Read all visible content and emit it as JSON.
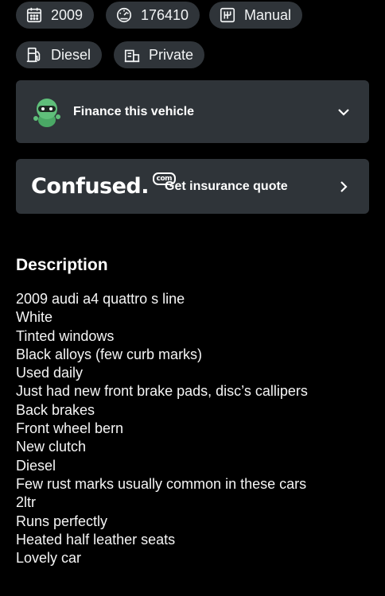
{
  "specs": {
    "year": "2009",
    "mileage": "176410",
    "transmission": "Manual",
    "fuel": "Diesel",
    "seller": "Private"
  },
  "finance": {
    "title": "Finance this vehicle"
  },
  "insurance": {
    "brand": "Confused.",
    "brand_suffix": "com",
    "label": "Get insurance quote"
  },
  "description": {
    "heading": "Description",
    "lines": [
      "2009 audi a4 quattro s line",
      "White",
      "Tinted windows",
      "Black alloys (few curb marks)",
      "Used daily",
      "Just had new front brake pads, disc’s callipers",
      "Back brakes",
      "Front wheel bern",
      "New clutch",
      "Diesel",
      "Few rust marks usually common in these cars",
      "2ltr",
      "Runs perfectly",
      "Heated half leather seats",
      "Lovely car"
    ]
  },
  "colors": {
    "background": "#000000",
    "chip": "#2f3439",
    "text": "#ffffff",
    "mascot": "#5fbf7a"
  }
}
